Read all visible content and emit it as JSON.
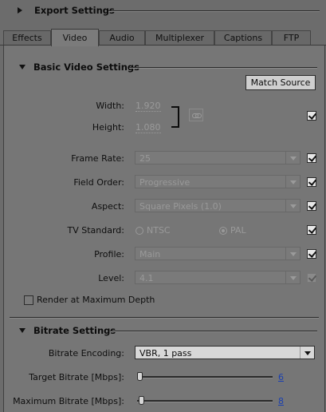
{
  "export_settings": {
    "title": "Export Settings"
  },
  "tabs": [
    {
      "label": "Effects",
      "active": false
    },
    {
      "label": "Video",
      "active": true
    },
    {
      "label": "Audio",
      "active": false
    },
    {
      "label": "Multiplexer",
      "active": false
    },
    {
      "label": "Captions",
      "active": false
    },
    {
      "label": "FTP",
      "active": false
    }
  ],
  "basic_video": {
    "title": "Basic Video Settings",
    "match_source_label": "Match Source",
    "width_label": "Width:",
    "width_value": "1.920",
    "height_label": "Height:",
    "height_value": "1.080",
    "frame_rate_label": "Frame Rate:",
    "frame_rate_value": "25",
    "field_order_label": "Field Order:",
    "field_order_value": "Progressive",
    "aspect_label": "Aspect:",
    "aspect_value": "Square Pixels (1.0)",
    "tv_standard_label": "TV Standard:",
    "tv_standard_options": [
      "NTSC",
      "PAL"
    ],
    "tv_standard_selected": "PAL",
    "profile_label": "Profile:",
    "profile_value": "Main",
    "level_label": "Level:",
    "level_value": "4.1",
    "render_max_depth_label": "Render at Maximum Depth",
    "render_max_depth_checked": false
  },
  "bitrate": {
    "title": "Bitrate Settings",
    "encoding_label": "Bitrate Encoding:",
    "encoding_value": "VBR, 1 pass",
    "target_label": "Target Bitrate [Mbps]:",
    "target_value": "6",
    "maximum_label": "Maximum Bitrate [Mbps]:",
    "maximum_value": "8"
  },
  "colors": {
    "link": "#1a3fb0",
    "background": "#6c6c6c",
    "panel": "#767676"
  }
}
